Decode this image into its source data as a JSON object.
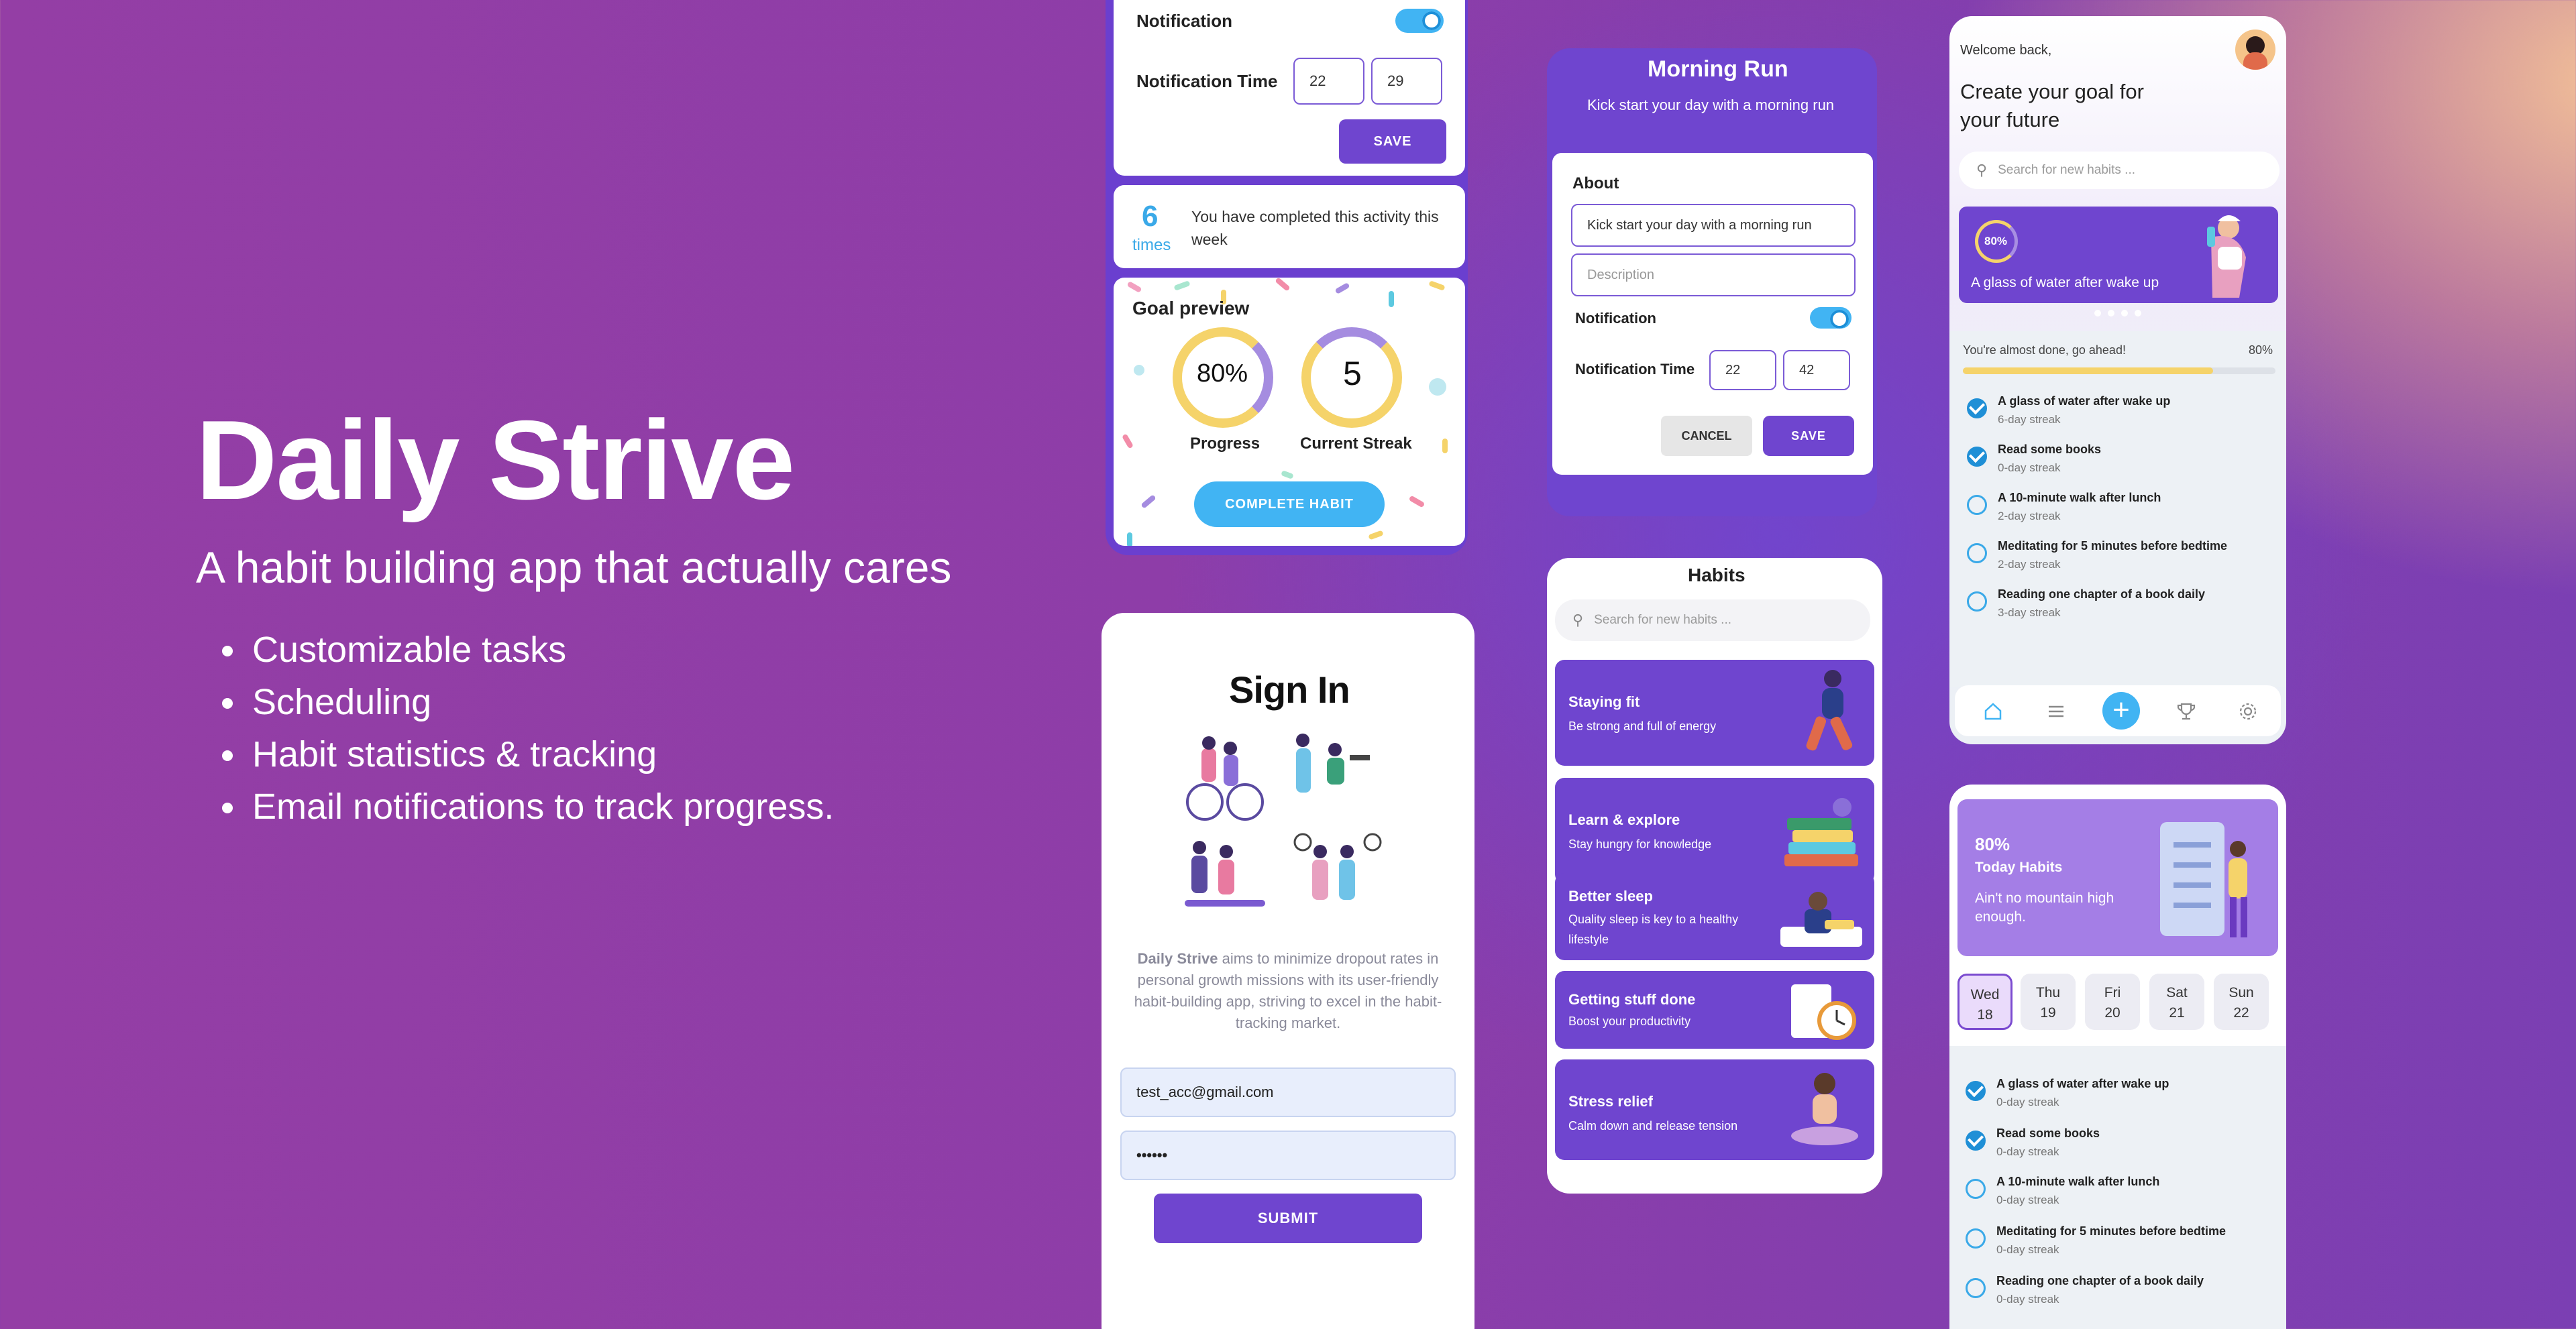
{
  "hero": {
    "title": "Daily Strive",
    "subtitle": "A habit building app that actually cares",
    "features": [
      "Customizable tasks",
      "Scheduling",
      "Habit statistics & tracking",
      "Email notifications to track progress."
    ]
  },
  "detail_screen": {
    "notification_label": "Notification",
    "notification_time_label": "Notification Time",
    "hour": "22",
    "minute": "29",
    "save_label": "SAVE",
    "times_count": "6",
    "times_label": "times",
    "completed_text": "You have completed this activity this week",
    "goal_preview_title": "Goal preview",
    "progress_value": "80%",
    "progress_label": "Progress",
    "streak_value": "5",
    "streak_label": "Current Streak",
    "complete_label": "COMPLETE HABIT"
  },
  "signin_screen": {
    "title": "Sign In",
    "brand": "Daily Strive",
    "description": " aims to minimize dropout rates in personal growth missions with its user-friendly habit-building app, striving to excel in the habit-tracking market.",
    "email_value": "test_acc@gmail.com",
    "password_value": "••••••",
    "submit_label": "SUBMIT"
  },
  "edit_screen": {
    "title": "Morning Run",
    "subtitle": "Kick start your day with a morning run",
    "about_label": "About",
    "about_value": "Kick start your day with a morning run",
    "description_placeholder": "Description",
    "notification_label": "Notification",
    "notification_time_label": "Notification Time",
    "hour": "22",
    "minute": "42",
    "cancel_label": "CANCEL",
    "save_label": "SAVE"
  },
  "habits_screen": {
    "title": "Habits",
    "search_placeholder": "Search for new habits ...",
    "categories": [
      {
        "title": "Staying fit",
        "subtitle": "Be strong and full of energy"
      },
      {
        "title": "Learn & explore",
        "subtitle": "Stay hungry for knowledge"
      },
      {
        "title": "Better sleep",
        "subtitle": "Quality sleep is key to a healthy lifestyle"
      },
      {
        "title": "Getting stuff done",
        "subtitle": "Boost your productivity"
      },
      {
        "title": "Stress relief",
        "subtitle": "Calm down and release tension"
      }
    ]
  },
  "home_screen": {
    "welcome": "Welcome back,",
    "headline": "Create your goal for your future",
    "search_placeholder": "Search for new habits ...",
    "banner_percent": "80%",
    "banner_text": "A glass of water after wake up",
    "progress_text": "You're almost done, go ahead!",
    "progress_value": "80%",
    "progress_fraction": 0.8,
    "habits": [
      {
        "title": "A glass of water after wake up",
        "streak": "6-day streak",
        "done": true
      },
      {
        "title": "Read some books",
        "streak": "0-day streak",
        "done": true
      },
      {
        "title": "A 10-minute walk after lunch",
        "streak": "2-day streak",
        "done": false
      },
      {
        "title": "Meditating for 5 minutes before bedtime",
        "streak": "2-day streak",
        "done": false
      },
      {
        "title": "Reading one chapter of a book daily",
        "streak": "3-day streak",
        "done": false
      }
    ]
  },
  "today_screen": {
    "percent": "80%",
    "title": "Today Habits",
    "subtitle": "Ain't no mountain high enough.",
    "days": [
      {
        "name": "Wed",
        "num": "18"
      },
      {
        "name": "Thu",
        "num": "19"
      },
      {
        "name": "Fri",
        "num": "20"
      },
      {
        "name": "Sat",
        "num": "21"
      },
      {
        "name": "Sun",
        "num": "22"
      }
    ],
    "habits": [
      {
        "title": "A glass of water after wake up",
        "streak": "0-day streak",
        "done": true
      },
      {
        "title": "Read some books",
        "streak": "0-day streak",
        "done": true
      },
      {
        "title": "A 10-minute walk after lunch",
        "streak": "0-day streak",
        "done": false
      },
      {
        "title": "Meditating for 5 minutes before bedtime",
        "streak": "0-day streak",
        "done": false
      },
      {
        "title": "Reading one chapter of a book daily",
        "streak": "0-day streak",
        "done": false
      }
    ]
  },
  "colors": {
    "brand_purple": "#6f45cf",
    "accent_blue": "#41b4f3",
    "progress_yellow": "#f5d36a"
  }
}
